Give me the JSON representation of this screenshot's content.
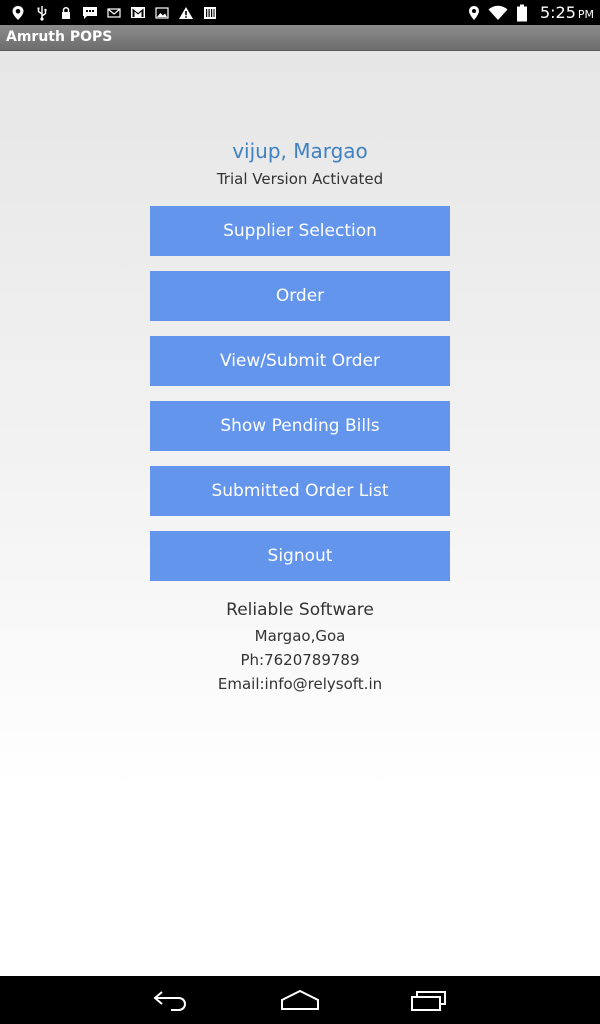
{
  "status_bar": {
    "time": "5:25",
    "ampm": "PM",
    "left_icons": [
      "location-pin-icon",
      "usb-icon",
      "lock-icon",
      "chat-icon",
      "voicemail-icon",
      "gmail-icon",
      "image-icon",
      "warning-icon",
      "barcode-icon"
    ],
    "right_icons": [
      "location-icon",
      "wifi-icon",
      "battery-icon"
    ]
  },
  "app_bar": {
    "title": "Amruth POPS"
  },
  "header": {
    "user_name": "vijup, Margao",
    "trial_status": "Trial Version Activated"
  },
  "menu": {
    "supplier_selection": "Supplier Selection",
    "order": "Order",
    "view_submit_order": "View/Submit Order",
    "show_pending_bills": "Show Pending Bills",
    "submitted_order_list": "Submitted Order List",
    "signout": "Signout"
  },
  "footer": {
    "company": "Reliable Software",
    "location": "Margao,Goa",
    "phone": "Ph:7620789789",
    "email": "Email:info@relysoft.in"
  },
  "nav_bar": {
    "icons": [
      "back-icon",
      "home-icon",
      "recent-apps-icon"
    ]
  },
  "colors": {
    "button": "#6495ed",
    "user_name": "#3f81c1",
    "app_bar": "#7b7b7b"
  }
}
